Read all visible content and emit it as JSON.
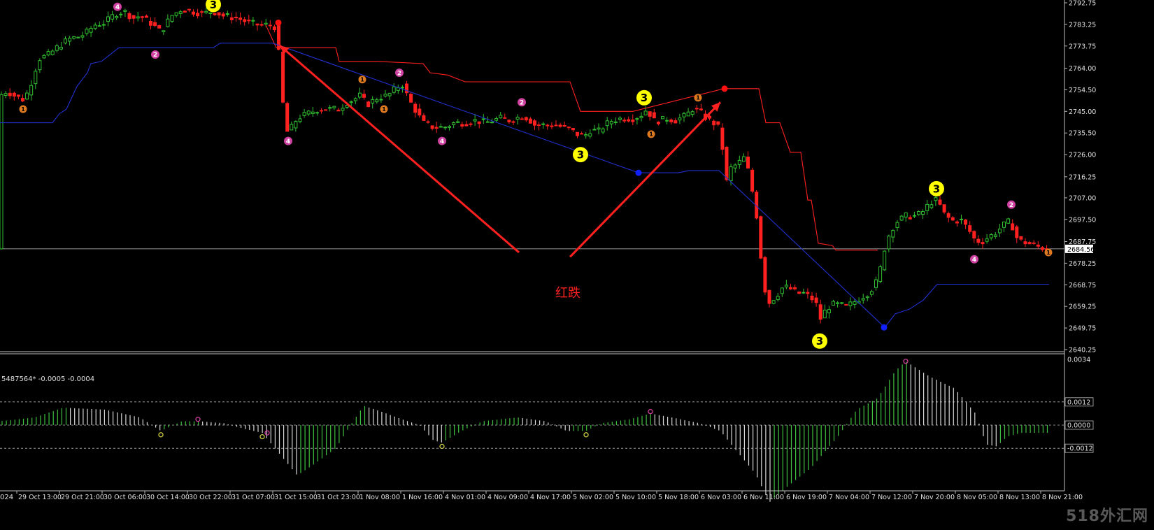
{
  "chart_data": {
    "type": "candlestick",
    "price_ylim": [
      2640.25,
      2792.75
    ],
    "price_ticks": [
      "2792.75",
      "2783.25",
      "2773.75",
      "2764.00",
      "2754.50",
      "2745.00",
      "2735.50",
      "2726.00",
      "2716.25",
      "2707.00",
      "2697.50",
      "2687.75",
      "2678.25",
      "2668.75",
      "2659.25",
      "2649.75",
      "2640.25"
    ],
    "current_price": "2684.56",
    "osc_ylim": [
      -0.0034,
      0.0034
    ],
    "osc_ticks": [
      "0.0034",
      "0.0012",
      "0.0000",
      "-0.0012"
    ],
    "osc_levels": [
      0.0012,
      0.0,
      -0.0012
    ],
    "osc_label": "5487564* -0.0005 -0.0004",
    "time_labels": [
      "29 Oct 13:00",
      "29 Oct 21:00",
      "30 Oct 06:00",
      "30 Oct 14:00",
      "30 Oct 22:00",
      "31 Oct 07:00",
      "31 Oct 15:00",
      "31 Oct 23:00",
      "1 Nov 08:00",
      "1 Nov 16:00",
      "4 Nov 01:00",
      "4 Nov 09:00",
      "4 Nov 17:00",
      "5 Nov 02:00",
      "5 Nov 10:00",
      "5 Nov 18:00",
      "6 Nov 03:00",
      "6 Nov 11:00",
      "6 Nov 19:00",
      "7 Nov 04:00",
      "7 Nov 12:00",
      "7 Nov 20:00",
      "8 Nov 05:00",
      "8 Nov 13:00",
      "8 Nov 21:00"
    ],
    "close_path": [
      [
        0,
        2752
      ],
      [
        10,
        2754
      ],
      [
        20,
        2752
      ],
      [
        35,
        2750
      ],
      [
        45,
        2758
      ],
      [
        55,
        2768
      ],
      [
        70,
        2770
      ],
      [
        85,
        2774
      ],
      [
        100,
        2777
      ],
      [
        115,
        2778
      ],
      [
        125,
        2780
      ],
      [
        135,
        2783
      ],
      [
        150,
        2784
      ],
      [
        165,
        2788
      ],
      [
        178,
        2789
      ],
      [
        190,
        2786
      ],
      [
        200,
        2787
      ],
      [
        215,
        2784
      ],
      [
        230,
        2780
      ],
      [
        245,
        2787
      ],
      [
        260,
        2790
      ],
      [
        275,
        2789
      ],
      [
        290,
        2788
      ],
      [
        305,
        2789
      ],
      [
        320,
        2787
      ],
      [
        340,
        2786
      ],
      [
        355,
        2784
      ],
      [
        370,
        2783
      ],
      [
        385,
        2783
      ],
      [
        395,
        2782
      ],
      [
        398,
        2773
      ],
      [
        402,
        2755
      ],
      [
        406,
        2745
      ],
      [
        410,
        2736
      ],
      [
        415,
        2737
      ],
      [
        425,
        2742
      ],
      [
        440,
        2744
      ],
      [
        455,
        2746
      ],
      [
        470,
        2746
      ],
      [
        485,
        2746
      ],
      [
        495,
        2749
      ],
      [
        505,
        2750
      ],
      [
        515,
        2752
      ],
      [
        525,
        2748
      ],
      [
        540,
        2751
      ],
      [
        555,
        2752
      ],
      [
        565,
        2755
      ],
      [
        575,
        2757
      ],
      [
        585,
        2750
      ],
      [
        595,
        2745
      ],
      [
        605,
        2740
      ],
      [
        620,
        2738
      ],
      [
        635,
        2738
      ],
      [
        650,
        2740
      ],
      [
        665,
        2740
      ],
      [
        680,
        2741
      ],
      [
        695,
        2740
      ],
      [
        705,
        2741
      ],
      [
        715,
        2742
      ],
      [
        730,
        2741
      ],
      [
        745,
        2743
      ],
      [
        755,
        2742
      ],
      [
        765,
        2739
      ],
      [
        780,
        2739
      ],
      [
        795,
        2739
      ],
      [
        805,
        2738
      ],
      [
        815,
        2737
      ],
      [
        825,
        2735
      ],
      [
        835,
        2734
      ],
      [
        845,
        2737
      ],
      [
        855,
        2736
      ],
      [
        865,
        2739
      ],
      [
        875,
        2741
      ],
      [
        890,
        2742
      ],
      [
        905,
        2742
      ],
      [
        915,
        2743
      ],
      [
        925,
        2746
      ],
      [
        935,
        2741
      ],
      [
        945,
        2741
      ],
      [
        955,
        2742
      ],
      [
        965,
        2741
      ],
      [
        980,
        2743
      ],
      [
        990,
        2746
      ],
      [
        1000,
        2745
      ],
      [
        1010,
        2742
      ],
      [
        1020,
        2740
      ],
      [
        1030,
        2737
      ],
      [
        1035,
        2723
      ],
      [
        1040,
        2712
      ],
      [
        1045,
        2720
      ],
      [
        1055,
        2722
      ],
      [
        1065,
        2725
      ],
      [
        1072,
        2716
      ],
      [
        1078,
        2706
      ],
      [
        1085,
        2693
      ],
      [
        1090,
        2672
      ],
      [
        1095,
        2665
      ],
      [
        1100,
        2661
      ],
      [
        1110,
        2664
      ],
      [
        1120,
        2668
      ],
      [
        1130,
        2667
      ],
      [
        1140,
        2665
      ],
      [
        1150,
        2665
      ],
      [
        1160,
        2663
      ],
      [
        1170,
        2659
      ],
      [
        1175,
        2651
      ],
      [
        1180,
        2658
      ],
      [
        1190,
        2660
      ],
      [
        1200,
        2660
      ],
      [
        1210,
        2659
      ],
      [
        1220,
        2661
      ],
      [
        1230,
        2663
      ],
      [
        1240,
        2665
      ],
      [
        1250,
        2668
      ],
      [
        1257,
        2673
      ],
      [
        1262,
        2682
      ],
      [
        1270,
        2690
      ],
      [
        1280,
        2696
      ],
      [
        1295,
        2699
      ],
      [
        1310,
        2699
      ],
      [
        1320,
        2701
      ],
      [
        1330,
        2705
      ],
      [
        1340,
        2706
      ],
      [
        1350,
        2700
      ],
      [
        1360,
        2697
      ],
      [
        1375,
        2697
      ],
      [
        1385,
        2693
      ],
      [
        1395,
        2688
      ],
      [
        1405,
        2688
      ],
      [
        1415,
        2690
      ],
      [
        1425,
        2692
      ],
      [
        1435,
        2695
      ],
      [
        1445,
        2697
      ],
      [
        1452,
        2690
      ],
      [
        1460,
        2688
      ],
      [
        1470,
        2687
      ],
      [
        1480,
        2686
      ],
      [
        1490,
        2685
      ],
      [
        1500,
        2684.56
      ]
    ],
    "series": [
      {
        "name": "",
        "color": "#ff2020",
        "values": [
          [
            380,
            2783
          ],
          [
            395,
            2773
          ],
          [
            440,
            2773
          ],
          [
            480,
            2773
          ],
          [
            485,
            2767
          ],
          [
            540,
            2767
          ],
          [
            605,
            2766
          ],
          [
            615,
            2762
          ],
          [
            640,
            2761
          ],
          [
            665,
            2758
          ],
          [
            815,
            2758
          ],
          [
            830,
            2745
          ],
          [
            905,
            2745
          ],
          [
            1035,
            2755
          ],
          [
            1085,
            2755
          ],
          [
            1095,
            2740
          ],
          [
            1115,
            2740
          ],
          [
            1130,
            2727
          ],
          [
            1145,
            2727
          ],
          [
            1155,
            2706
          ],
          [
            1160,
            2706
          ],
          [
            1170,
            2687
          ],
          [
            1190,
            2686
          ],
          [
            1195,
            2684
          ],
          [
            1255,
            2684
          ]
        ]
      },
      {
        "name": "",
        "color": "#2030d0",
        "values": [
          [
            0,
            2740
          ],
          [
            75,
            2740
          ],
          [
            85,
            2744
          ],
          [
            95,
            2746
          ],
          [
            110,
            2756
          ],
          [
            125,
            2762
          ],
          [
            130,
            2766
          ],
          [
            145,
            2767
          ],
          [
            170,
            2773
          ],
          [
            305,
            2773
          ],
          [
            315,
            2775
          ],
          [
            390,
            2775
          ],
          [
            913,
            2718
          ],
          [
            970,
            2718
          ],
          [
            985,
            2719
          ],
          [
            1028,
            2719
          ],
          [
            1265,
            2650
          ],
          [
            1280,
            2656
          ],
          [
            1300,
            2658
          ],
          [
            1320,
            2662
          ],
          [
            1340,
            2669
          ],
          [
            1500,
            2669
          ]
        ]
      }
    ],
    "markers": [
      {
        "kind": "pink",
        "label": "4",
        "x": 168,
        "y": 2791
      },
      {
        "kind": "pink",
        "label": "2",
        "x": 222,
        "y": 2770
      },
      {
        "kind": "yellow",
        "label": "3",
        "x": 305,
        "y": 2792
      },
      {
        "kind": "orange",
        "label": "1",
        "x": 33,
        "y": 2746
      },
      {
        "kind": "pink",
        "label": "4",
        "x": 412,
        "y": 2732
      },
      {
        "kind": "orange",
        "label": "1",
        "x": 518,
        "y": 2759
      },
      {
        "kind": "orange",
        "label": "1",
        "x": 549,
        "y": 2746
      },
      {
        "kind": "pink",
        "label": "2",
        "x": 571,
        "y": 2762
      },
      {
        "kind": "pink",
        "label": "4",
        "x": 632,
        "y": 2732
      },
      {
        "kind": "pink",
        "label": "2",
        "x": 746,
        "y": 2749
      },
      {
        "kind": "yellow",
        "label": "3",
        "x": 830,
        "y": 2726
      },
      {
        "kind": "yellow",
        "label": "3",
        "x": 921,
        "y": 2751
      },
      {
        "kind": "orange",
        "label": "1",
        "x": 931,
        "y": 2735
      },
      {
        "kind": "orange",
        "label": "1",
        "x": 998,
        "y": 2751
      },
      {
        "kind": "yellow",
        "label": "3",
        "x": 1172,
        "y": 2644
      },
      {
        "kind": "yellow",
        "label": "3",
        "x": 1339,
        "y": 2711
      },
      {
        "kind": "pink",
        "label": "2",
        "x": 1446,
        "y": 2704
      },
      {
        "kind": "pink",
        "label": "4",
        "x": 1393,
        "y": 2680
      },
      {
        "kind": "orange",
        "label": "1",
        "x": 1499,
        "y": 2683
      }
    ],
    "dots": [
      {
        "color": "#ff1010",
        "x": 398,
        "y": 2784
      },
      {
        "color": "#ff1010",
        "x": 1036,
        "y": 2755
      },
      {
        "color": "#1020ff",
        "x": 913,
        "y": 2718
      },
      {
        "color": "#1020ff",
        "x": 1264,
        "y": 2650
      }
    ],
    "osc_path": [
      [
        0,
        0.0002
      ],
      [
        50,
        0.0004
      ],
      [
        90,
        0.0009
      ],
      [
        150,
        0.0008
      ],
      [
        200,
        0.0004
      ],
      [
        230,
        -0.0003
      ],
      [
        260,
        0.0002
      ],
      [
        285,
        0.0002
      ],
      [
        320,
        0.0001
      ],
      [
        350,
        -0.0002
      ],
      [
        375,
        -0.0004
      ],
      [
        400,
        -0.0015
      ],
      [
        425,
        -0.0026
      ],
      [
        450,
        -0.002
      ],
      [
        480,
        -0.0012
      ],
      [
        505,
        0.0002
      ],
      [
        520,
        0.001
      ],
      [
        545,
        0.0007
      ],
      [
        575,
        0.0003
      ],
      [
        600,
        0.0
      ],
      [
        620,
        -0.0008
      ],
      [
        632,
        -0.0009
      ],
      [
        660,
        -0.0003
      ],
      [
        690,
        0.0002
      ],
      [
        740,
        0.0004
      ],
      [
        780,
        0.0002
      ],
      [
        810,
        -0.0003
      ],
      [
        838,
        -0.0003
      ],
      [
        860,
        0.0001
      ],
      [
        900,
        0.0003
      ],
      [
        930,
        0.0006
      ],
      [
        960,
        0.0004
      ],
      [
        1000,
        0.0001
      ],
      [
        1030,
        -0.0003
      ],
      [
        1050,
        -0.0012
      ],
      [
        1080,
        -0.0025
      ],
      [
        1100,
        -0.004
      ],
      [
        1125,
        -0.0032
      ],
      [
        1160,
        -0.0022
      ],
      [
        1200,
        -0.0005
      ],
      [
        1225,
        0.0008
      ],
      [
        1255,
        0.0014
      ],
      [
        1280,
        0.0028
      ],
      [
        1295,
        0.0033
      ],
      [
        1330,
        0.0025
      ],
      [
        1365,
        0.0019
      ],
      [
        1395,
        0.0006
      ],
      [
        1410,
        -0.001
      ],
      [
        1425,
        -0.0011
      ],
      [
        1440,
        -0.0006
      ],
      [
        1460,
        -0.0004
      ],
      [
        1500,
        -0.0004
      ]
    ],
    "osc_markers": [
      {
        "color": "#cccc40",
        "x": 230,
        "y": -0.0005
      },
      {
        "color": "#d040a0",
        "x": 283,
        "y": 0.0003
      },
      {
        "color": "#cccc40",
        "x": 375,
        "y": -0.0006
      },
      {
        "color": "#d040a0",
        "x": 382,
        "y": -0.0004
      },
      {
        "color": "#cccc40",
        "x": 632,
        "y": -0.0011
      },
      {
        "color": "#cccc40",
        "x": 838,
        "y": -0.0005
      },
      {
        "color": "#d040a0",
        "x": 930,
        "y": 0.0007
      },
      {
        "color": "#d040a0",
        "x": 1295,
        "y": 0.0033
      }
    ]
  },
  "annotation": {
    "text": "红跌",
    "color": "#ff2020"
  },
  "arrows": [
    {
      "from": [
        742,
        2683
      ],
      "to": [
        400,
        2774
      ],
      "color": "#ff2020"
    },
    {
      "from": [
        815,
        2681
      ],
      "to": [
        1030,
        2749
      ],
      "color": "#ff2020"
    }
  ],
  "left_clipped_label": "024",
  "watermark": "518外汇网",
  "colors": {
    "bull": "#30c030",
    "bear": "#ff2020",
    "axis_text": "#e0e0e0",
    "grid": "#888888"
  }
}
